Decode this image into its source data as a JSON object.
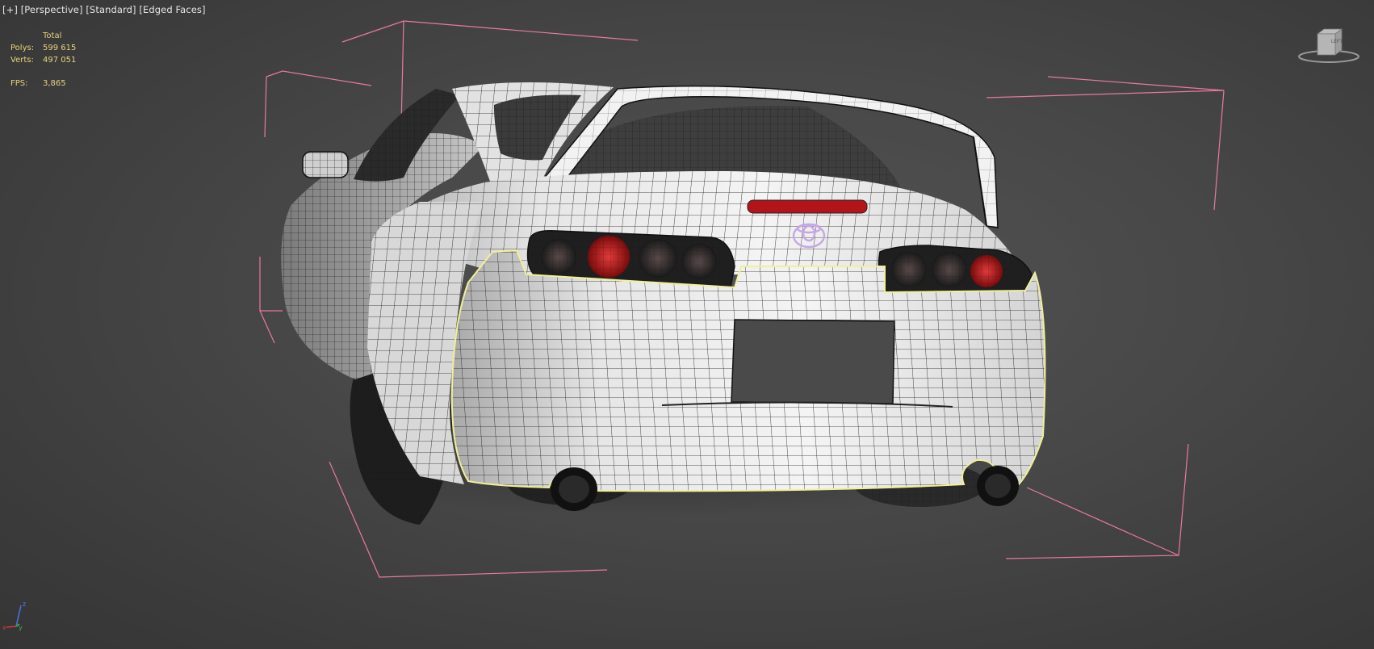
{
  "viewport": {
    "menu_plus": "[+]",
    "view_mode": "[Perspective]",
    "shading_mode": "[Standard]",
    "display_mode": "[Edged Faces]"
  },
  "stats": {
    "header": "Total",
    "polys_label": "Polys:",
    "polys_value": "599 615",
    "verts_label": "Verts:",
    "verts_value": "497 051",
    "fps_label": "FPS:",
    "fps_value": "3,865"
  },
  "viewcube": {
    "face_label": "LEFT"
  },
  "axis_gizmo": {
    "x_label": "x",
    "y_label": "y",
    "z_label": "z"
  },
  "colors": {
    "selection_box": "#e87a9a",
    "selection_outline": "#f2ee9a",
    "stats_text": "#e8d27a",
    "tail_light_red": "#c2161c",
    "emblem": "#c7a6e6"
  }
}
